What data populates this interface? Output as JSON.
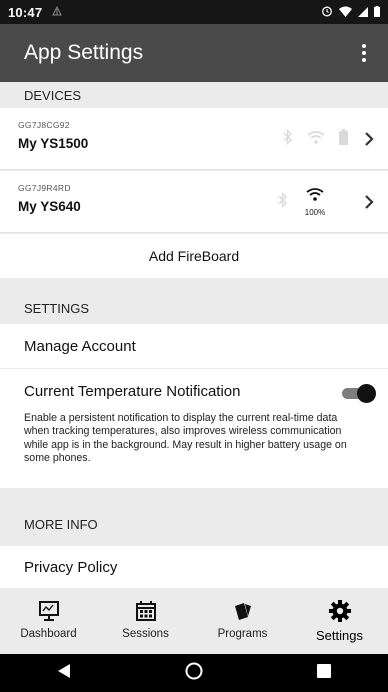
{
  "status_bar": {
    "time": "10:47",
    "icons": [
      "signal-icon",
      "alarm-icon",
      "wifi-icon",
      "cell-icon",
      "battery-icon"
    ]
  },
  "app_bar": {
    "title": "App Settings",
    "menu_icon": "more-vert-icon"
  },
  "devices": {
    "header": "DEVICES",
    "items": [
      {
        "id": "GG7J8CG92",
        "name": "My YS1500",
        "bluetooth": "off",
        "wifi": "off",
        "battery": "off",
        "signal_text": ""
      },
      {
        "id": "GG7J9R4RD",
        "name": "My YS640",
        "bluetooth": "off",
        "wifi": "on",
        "battery": "",
        "signal_text": "100%"
      }
    ],
    "add_label": "Add FireBoard"
  },
  "settings": {
    "header": "SETTINGS",
    "manage_account": "Manage Account",
    "notification": {
      "label": "Current Temperature Notification",
      "enabled": true,
      "description": "Enable a persistent notification to display the current real-time data when tracking temperatures, also improves wireless communication while app is in the background. May result in higher battery usage on some phones."
    }
  },
  "more_info": {
    "header": "MORE INFO",
    "privacy_policy": "Privacy Policy"
  },
  "bottom_nav": {
    "tabs": [
      {
        "label": "Dashboard",
        "icon": "dashboard-icon"
      },
      {
        "label": "Sessions",
        "icon": "calendar-icon"
      },
      {
        "label": "Programs",
        "icon": "cards-icon"
      },
      {
        "label": "Settings",
        "icon": "gear-icon"
      }
    ],
    "active": "Settings"
  },
  "system_nav": {
    "icons": [
      "back-icon",
      "home-icon",
      "recents-icon"
    ]
  },
  "colors": {
    "app_bar": "#4a4a4a",
    "status_bar": "#161616",
    "background": "#ebebeb",
    "toggle_on": "#111111"
  }
}
